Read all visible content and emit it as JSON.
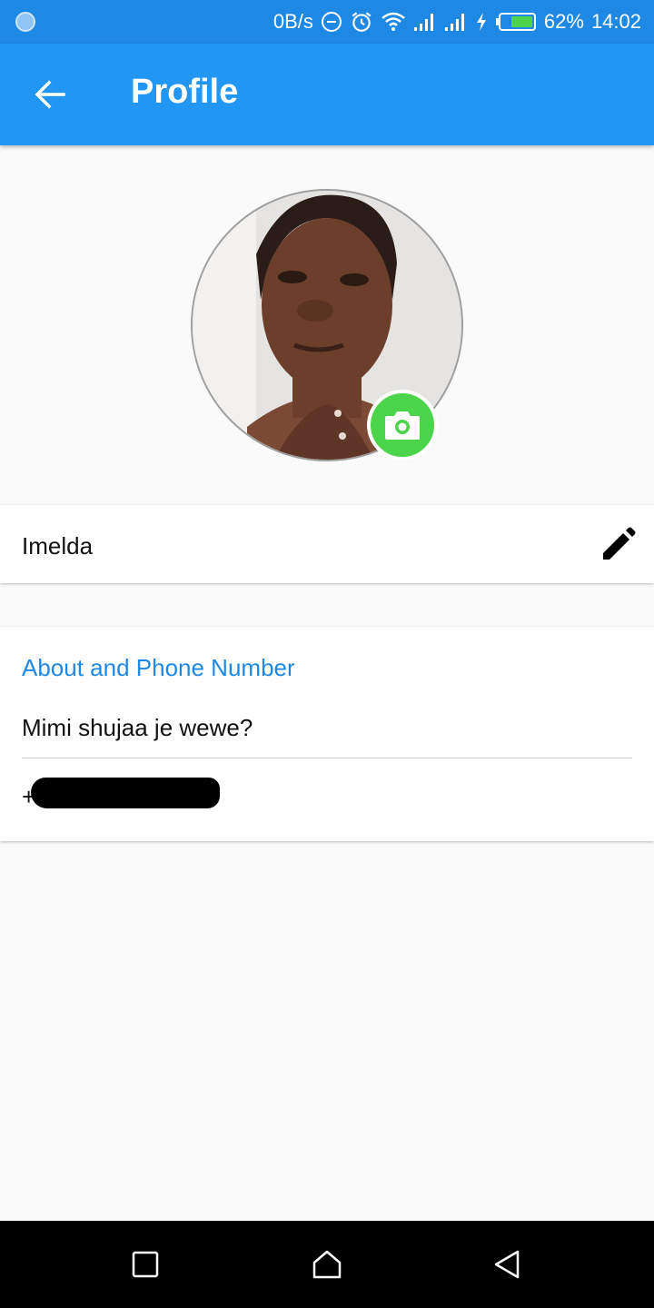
{
  "status_bar": {
    "net_speed": "0B/s",
    "battery": "62%",
    "time": "14:02"
  },
  "app_bar": {
    "title": "Profile"
  },
  "profile": {
    "name": "Imelda",
    "section_title": "About and Phone Number",
    "about": "Mimi shujaa je wewe?",
    "phone_visible_prefix": "+"
  },
  "colors": {
    "app_bar": "#2196f3",
    "status_bar": "#1e88e5",
    "accent_text": "#1e88e5",
    "camera_button": "#4cd44a"
  },
  "icons": {
    "back": "arrow-left-icon",
    "edit": "pencil-icon",
    "camera": "camera-icon",
    "nav_recent": "square-icon",
    "nav_home": "home-icon",
    "nav_back": "triangle-back-icon"
  }
}
